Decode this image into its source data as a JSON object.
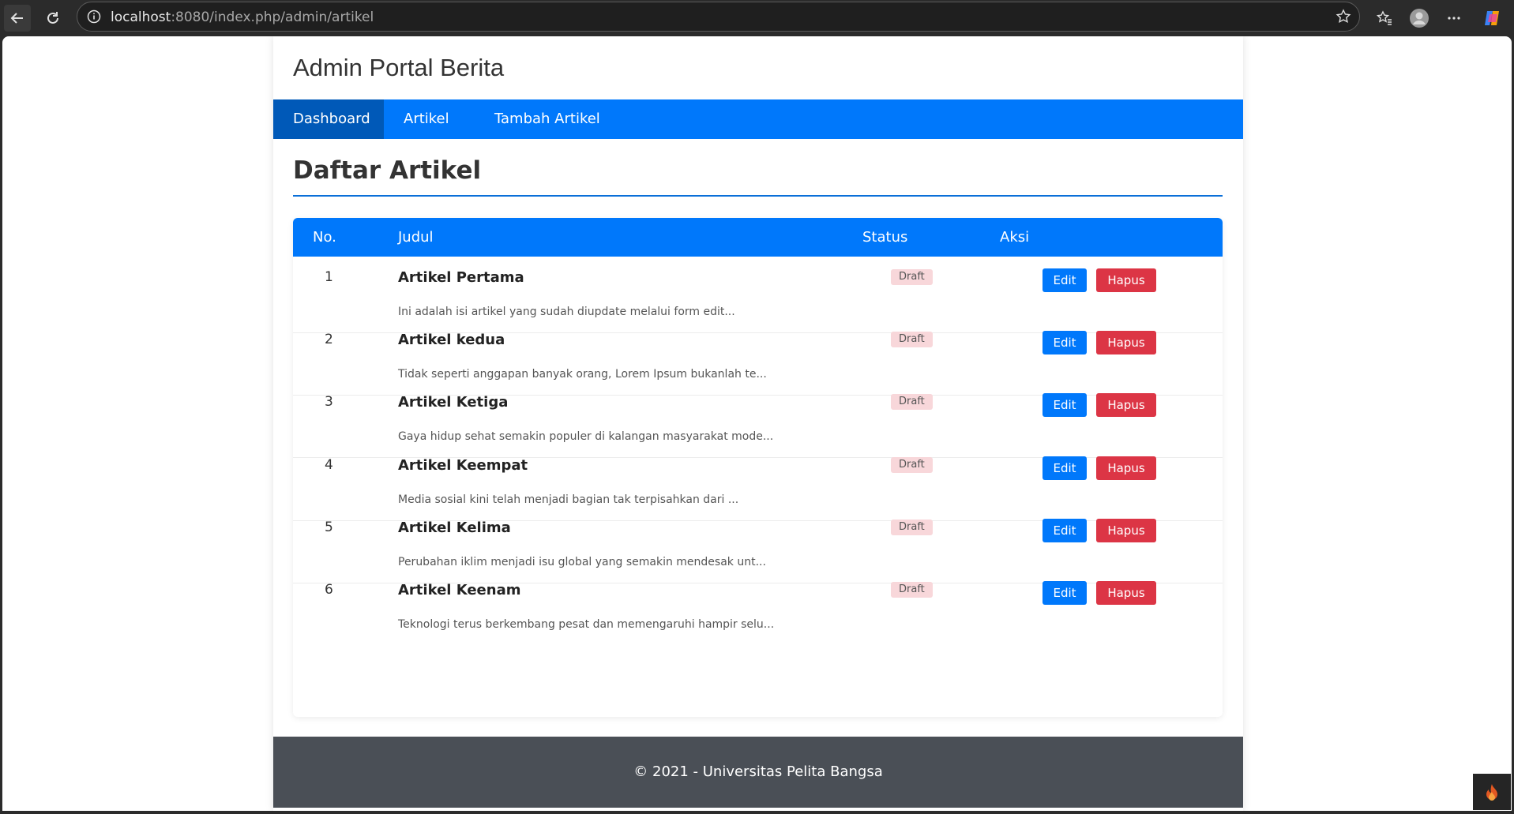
{
  "browser": {
    "url_host": "localhost",
    "url_rest": ":8080/index.php/admin/artikel"
  },
  "site": {
    "title": "Admin Portal Berita"
  },
  "nav": {
    "items": [
      {
        "label": "Dashboard"
      },
      {
        "label": "Artikel"
      },
      {
        "label": "Tambah Artikel"
      }
    ]
  },
  "page": {
    "title": "Daftar Artikel"
  },
  "table": {
    "headers": {
      "no": "No.",
      "judul": "Judul",
      "status": "Status",
      "aksi": "Aksi"
    },
    "rows": [
      {
        "no": "1",
        "title": "Artikel Pertama",
        "excerpt": "Ini adalah isi artikel yang sudah diupdate melalui form edit...",
        "status": "Draft",
        "edit": "Edit",
        "hapus": "Hapus"
      },
      {
        "no": "2",
        "title": "Artikel kedua",
        "excerpt": "Tidak seperti anggapan banyak orang, Lorem Ipsum bukanlah te...",
        "status": "Draft",
        "edit": "Edit",
        "hapus": "Hapus"
      },
      {
        "no": "3",
        "title": "Artikel Ketiga",
        "excerpt": "Gaya hidup sehat semakin populer di kalangan masyarakat mode...",
        "status": "Draft",
        "edit": "Edit",
        "hapus": "Hapus"
      },
      {
        "no": "4",
        "title": "Artikel Keempat",
        "excerpt": "Media sosial kini telah menjadi bagian tak terpisahkan dari ...",
        "status": "Draft",
        "edit": "Edit",
        "hapus": "Hapus"
      },
      {
        "no": "5",
        "title": "Artikel Kelima",
        "excerpt": "Perubahan iklim menjadi isu global yang semakin mendesak unt...",
        "status": "Draft",
        "edit": "Edit",
        "hapus": "Hapus"
      },
      {
        "no": "6",
        "title": "Artikel Keenam",
        "excerpt": "Teknologi terus berkembang pesat dan memengaruhi hampir selu...",
        "status": "Draft",
        "edit": "Edit",
        "hapus": "Hapus"
      }
    ]
  },
  "footer": {
    "text": "© 2021 - Universitas Pelita Bangsa"
  },
  "colors": {
    "primary": "#0078fb",
    "nav_active": "#0059b8",
    "danger": "#dc3545",
    "badge_bg": "#f8d7da",
    "footer_bg": "#4a4f56"
  },
  "icons": [
    "back-arrow-icon",
    "reload-icon",
    "site-info-icon",
    "star-icon",
    "favorites-icon",
    "profile-icon",
    "more-icon",
    "copilot-icon",
    "flame-icon"
  ]
}
